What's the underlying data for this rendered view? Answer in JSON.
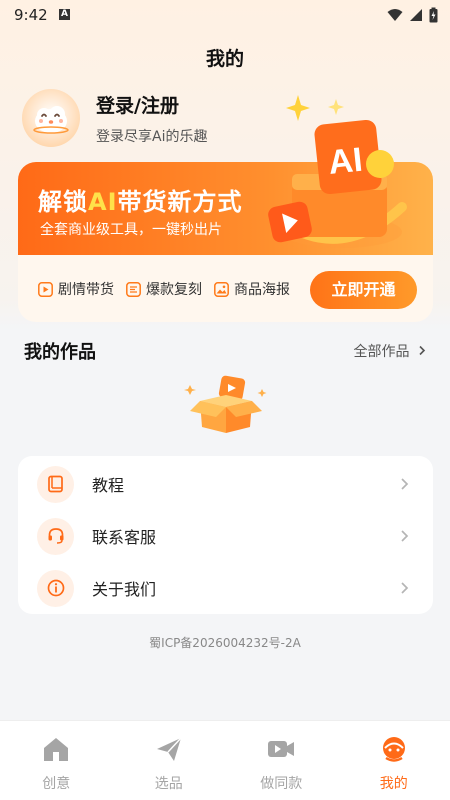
{
  "status_bar": {
    "time": "9:42",
    "notification_badge": "A",
    "icons": [
      "wifi-icon",
      "signal-icon",
      "battery-charging-icon"
    ]
  },
  "page": {
    "title": "我的"
  },
  "profile": {
    "login_label": "登录/注册",
    "subtitle": "登录尽享Ai的乐趣",
    "avatar": "cloud-mascot-avatar"
  },
  "promo": {
    "title_prefix": "解锁",
    "title_ai": "AI",
    "title_suffix": "带货新方式",
    "subtitle": "全套商业级工具，一键秒出片",
    "art_label": "AI",
    "features": [
      {
        "label": "剧情带货",
        "icon": "play-icon"
      },
      {
        "label": "爆款复刻",
        "icon": "copy-icon"
      },
      {
        "label": "商品海报",
        "icon": "image-icon"
      }
    ],
    "button_label": "立即开通",
    "colors": {
      "gradient_start": "#ff6a17",
      "gradient_end": "#ffb24a",
      "highlight": "#ffe24a"
    }
  },
  "works": {
    "title": "我的作品",
    "all_link": "全部作品",
    "empty_state": "empty-box-illustration"
  },
  "menu": [
    {
      "label": "教程",
      "icon": "book-icon"
    },
    {
      "label": "联系客服",
      "icon": "headset-icon"
    },
    {
      "label": "关于我们",
      "icon": "info-icon"
    }
  ],
  "footer": {
    "icp": "蜀ICP备2026004232号-2A"
  },
  "tabs": [
    {
      "label": "创意",
      "icon": "home-icon",
      "active": false
    },
    {
      "label": "选品",
      "icon": "send-icon",
      "active": false
    },
    {
      "label": "做同款",
      "icon": "video-icon",
      "active": false
    },
    {
      "label": "我的",
      "icon": "profile-icon",
      "active": true
    }
  ],
  "accent_color": "#ff6a17"
}
